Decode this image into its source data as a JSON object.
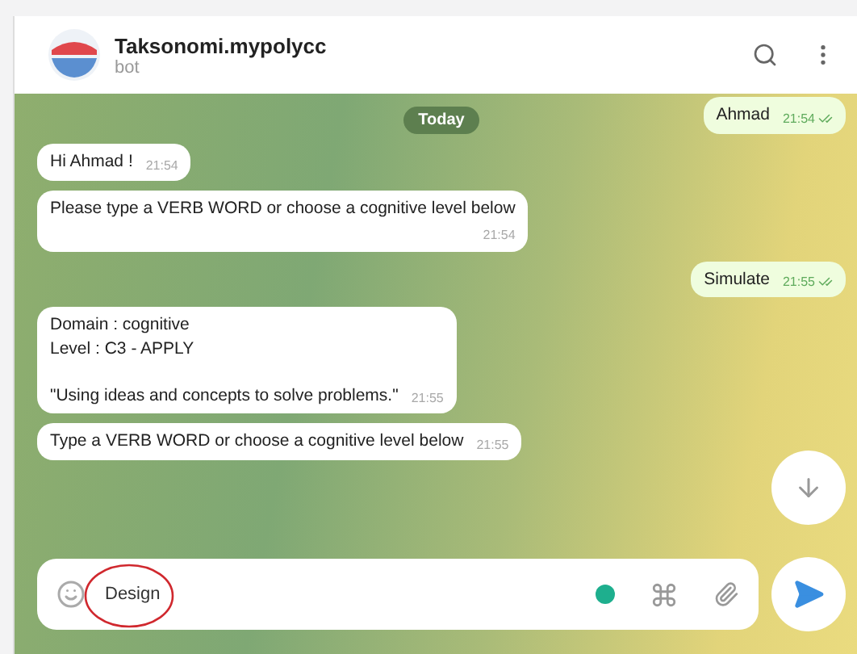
{
  "header": {
    "title": "Taksonomi.mypolycc",
    "subtitle": "bot"
  },
  "date_label": "Today",
  "messages": [
    {
      "kind": "outgoing",
      "lines": [
        "Ahmad"
      ],
      "time": "21:54",
      "inline_time": true
    },
    {
      "kind": "incoming",
      "lines": [
        "Hi Ahmad !"
      ],
      "time": "21:54",
      "inline_time": true
    },
    {
      "kind": "incoming",
      "lines": [
        "Please type a VERB WORD or choose a cognitive level below"
      ],
      "time": "21:54",
      "inline_time": false
    },
    {
      "kind": "outgoing",
      "lines": [
        "Simulate"
      ],
      "time": "21:55",
      "inline_time": true
    },
    {
      "kind": "incoming",
      "lines": [
        "Domain : cognitive",
        "Level : C3 - APPLY"
      ],
      "after_gap": [
        "\"Using ideas and concepts to solve problems.\""
      ],
      "time": "21:55",
      "inline_time": true
    },
    {
      "kind": "incoming",
      "lines": [
        "Type a VERB WORD or choose a cognitive level below"
      ],
      "time": "21:55",
      "inline_time": true
    }
  ],
  "composer": {
    "value": "Design",
    "highlighted": true
  }
}
